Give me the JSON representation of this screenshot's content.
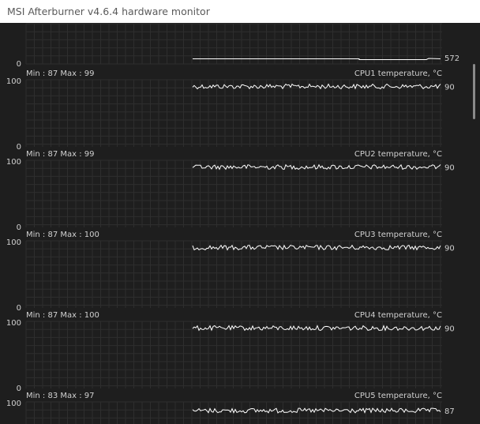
{
  "window": {
    "title": "MSI Afterburner v4.6.4 hardware monitor"
  },
  "colors": {
    "background": "#1e1e1e",
    "grid": "#2e2e2e",
    "line": "#ffffff",
    "text": "#d0d0d0"
  },
  "top_graph": {
    "min_label": "0",
    "current_value": "572"
  },
  "panels": [
    {
      "id": "cpu1",
      "max_label": "100",
      "min_label": "0",
      "min_max_text": "Min : 87   Max : 99",
      "title": "CPU1 temperature, °C",
      "current_value": "90",
      "level": 90
    },
    {
      "id": "cpu2",
      "max_label": "100",
      "min_label": "0",
      "min_max_text": "Min : 87   Max : 99",
      "title": "CPU2 temperature, °C",
      "current_value": "90",
      "level": 90
    },
    {
      "id": "cpu3",
      "max_label": "100",
      "min_label": "0",
      "min_max_text": "Min : 87   Max : 100",
      "title": "CPU3 temperature, °C",
      "current_value": "90",
      "level": 90
    },
    {
      "id": "cpu4",
      "max_label": "100",
      "min_label": "0",
      "min_max_text": "Min : 87   Max : 100",
      "title": "CPU4 temperature, °C",
      "current_value": "90",
      "level": 90
    },
    {
      "id": "cpu5",
      "max_label": "100",
      "min_label": "",
      "min_max_text": "Min : 83   Max : 97",
      "title": "CPU5 temperature, °C",
      "current_value": "87",
      "level": 87
    }
  ]
}
